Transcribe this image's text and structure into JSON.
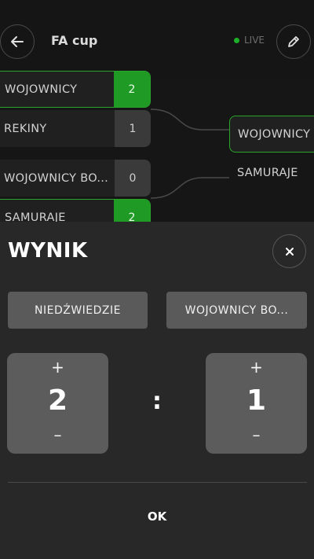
{
  "header": {
    "title": "FA cup",
    "live_label": "LIVE"
  },
  "bracket": {
    "round1": [
      {
        "team": "WOJOWNICY",
        "score": "2",
        "winner": true
      },
      {
        "team": "REKINY",
        "score": "1",
        "winner": false
      },
      {
        "team": "WOJOWNICY BO...",
        "score": "0",
        "winner": false
      },
      {
        "team": "SAMURAJE",
        "score": "2",
        "winner": true
      }
    ],
    "round2": [
      {
        "team": "WOJOWNICY",
        "winner": true
      },
      {
        "team": "SAMURAJE",
        "winner": false
      }
    ]
  },
  "dialog": {
    "title": "WYNIK",
    "home_team": "NIEDŹWIEDZIE",
    "away_team": "WOJOWNICY BO...",
    "home_score": "2",
    "away_score": "1",
    "separator": ":",
    "plus": "+",
    "minus": "–",
    "ok_label": "OK"
  },
  "colors": {
    "accent_green": "#1f9a25",
    "winner_border": "#2aa52a",
    "background": "#161616",
    "sheet": "#282828"
  },
  "icons": {
    "back": "arrow-left-icon",
    "edit": "pencil-icon",
    "close": "close-icon"
  }
}
